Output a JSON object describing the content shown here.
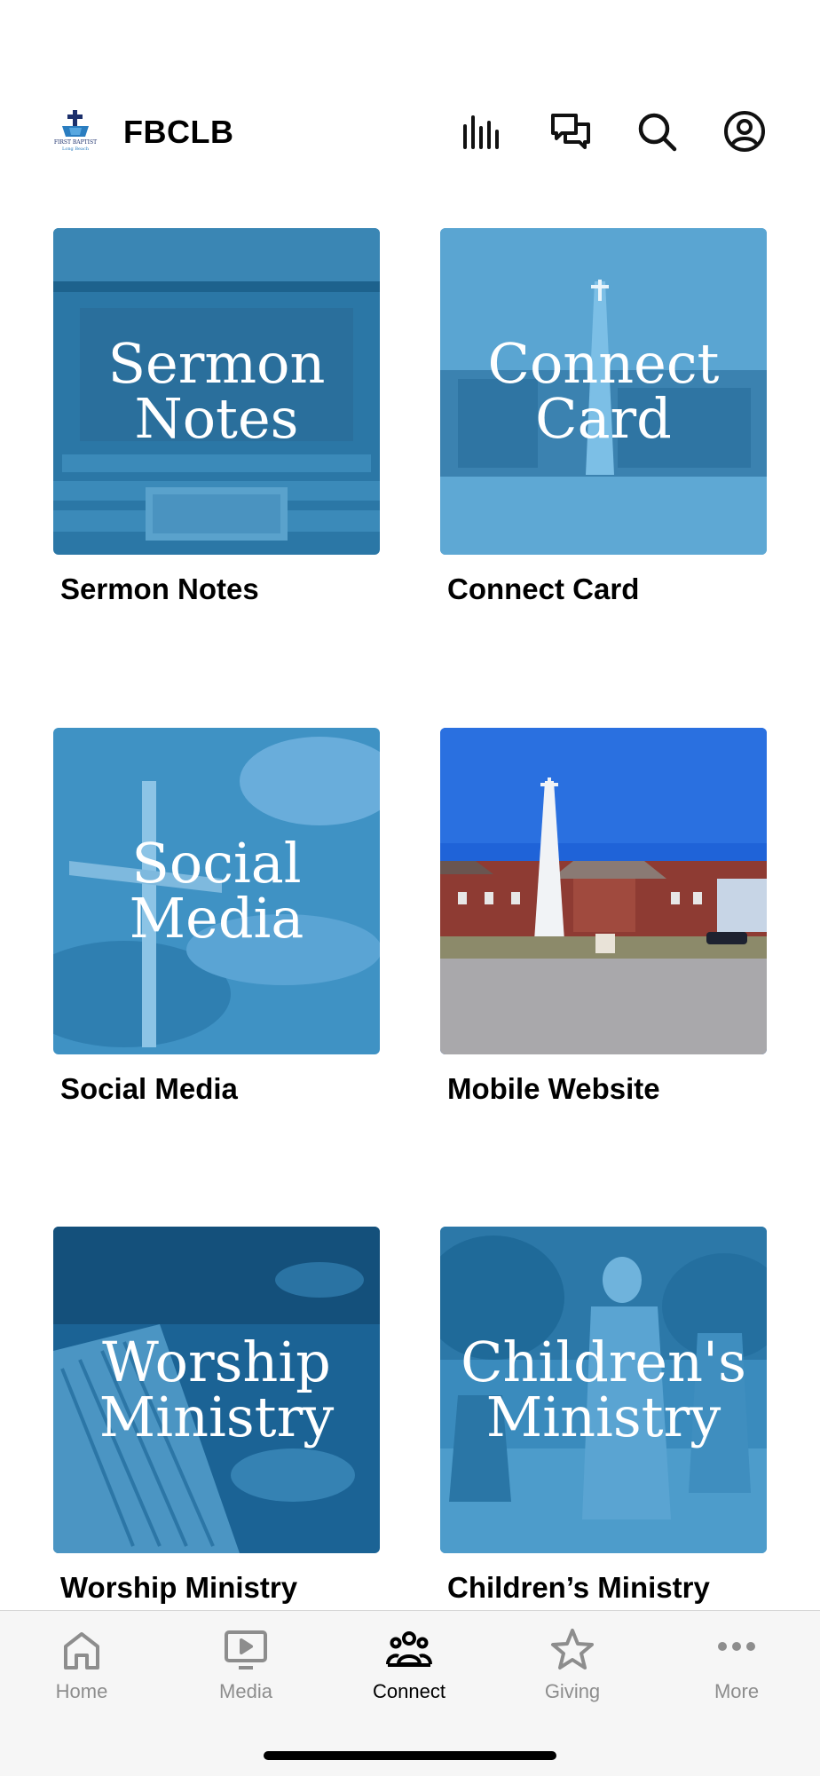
{
  "app": {
    "title": "FBCLB",
    "logo_icon": "church-cross-logo",
    "logo_caption": "FIRST BAPTIST",
    "logo_subcaption": "Long Beach"
  },
  "header_icons": [
    "audio-bars-icon",
    "chat-bubbles-icon",
    "search-icon",
    "account-icon"
  ],
  "tiles": [
    {
      "overlay": "Sermon\nNotes",
      "label": "Sermon Notes",
      "image": "sanctuary-interior"
    },
    {
      "overlay": "Connect\nCard",
      "label": "Connect Card",
      "image": "church-exterior-spire"
    },
    {
      "overlay": "Social\nMedia",
      "label": "Social Media",
      "image": "cross-sky"
    },
    {
      "overlay": "",
      "label": "Mobile Website",
      "image": "church-campus-photo"
    },
    {
      "overlay": "Worship\nMinistry",
      "label": "Worship Ministry",
      "image": "piano-keys"
    },
    {
      "overlay": "Children's\nMinistry",
      "label": "Children’s Ministry",
      "image": "children-outdoor-race"
    }
  ],
  "tabbar": {
    "items": [
      {
        "label": "Home",
        "icon": "home-icon",
        "active": false
      },
      {
        "label": "Media",
        "icon": "play-screen-icon",
        "active": false
      },
      {
        "label": "Connect",
        "icon": "group-people-icon",
        "active": true
      },
      {
        "label": "Giving",
        "icon": "star-icon",
        "active": false
      },
      {
        "label": "More",
        "icon": "more-dots-icon",
        "active": false
      }
    ]
  },
  "colors": {
    "accent_blue": "#2f7fb1",
    "overlay_blue": "#1f6e9e",
    "tab_inactive": "#8d8d8d",
    "tab_active": "#000000"
  }
}
